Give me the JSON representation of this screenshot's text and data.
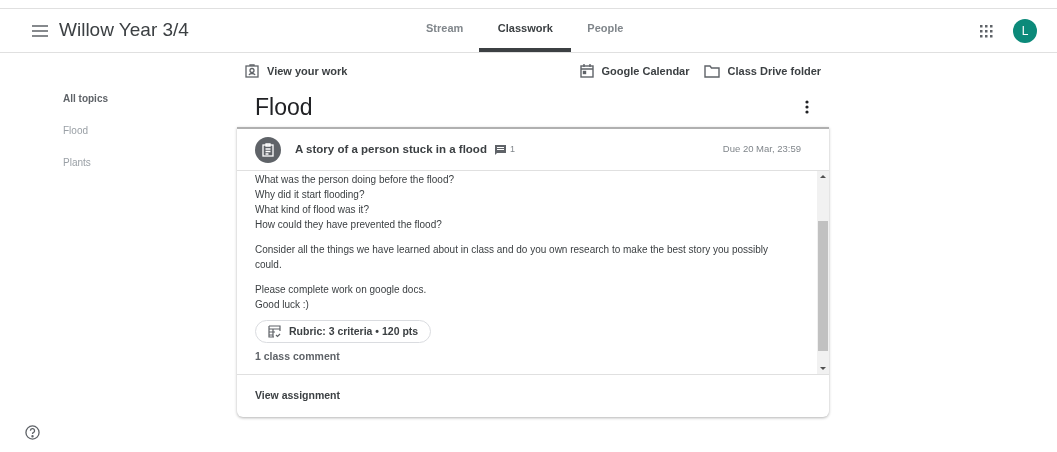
{
  "header": {
    "title": "Willow Year 3/4",
    "avatar": "L"
  },
  "tabs": [
    {
      "label": "Stream",
      "selected": false
    },
    {
      "label": "Classwork",
      "selected": true
    },
    {
      "label": "People",
      "selected": false
    }
  ],
  "toolbar": {
    "view_work": "View your work",
    "calendar": "Google Calendar",
    "drive": "Class Drive folder"
  },
  "sidebar": {
    "items": [
      {
        "label": "All topics",
        "selected": true
      },
      {
        "label": "Flood",
        "selected": false
      },
      {
        "label": "Plants",
        "selected": false
      }
    ]
  },
  "topic": {
    "title": "Flood"
  },
  "assignment": {
    "title": "A story of a person stuck in a flood",
    "comment_count": "1",
    "due": "Due 20 Mar, 23:59",
    "paragraphs": [
      [
        "What was the person doing before the flood?",
        "Why did it start flooding?",
        "What kind of flood was it?",
        "How could they have prevented the flood?"
      ],
      [
        "Consider all the things we have learned about in class and do you own research to make the best story you possibly could."
      ],
      [
        "Please complete work on google docs.",
        "Good luck :)"
      ]
    ],
    "rubric": "Rubric: 3 criteria • 120 pts",
    "class_comments": "1 class comment",
    "action": "View assignment"
  }
}
